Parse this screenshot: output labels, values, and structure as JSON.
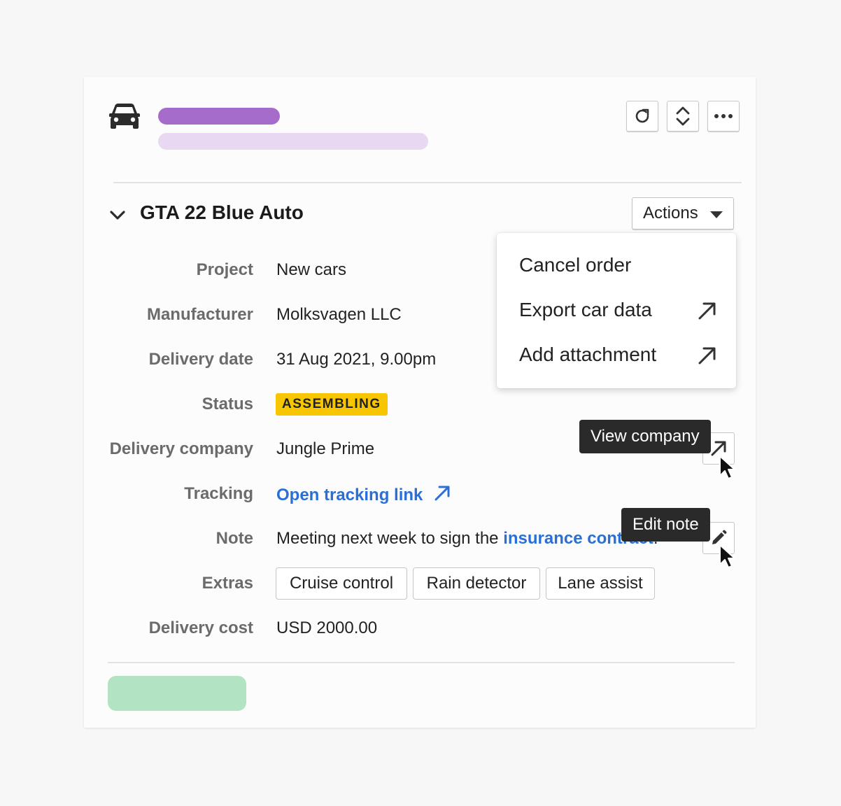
{
  "header": {
    "icon": "car-icon",
    "buttons": [
      {
        "name": "refresh-icon"
      },
      {
        "name": "expand-collapse-icon"
      },
      {
        "name": "more-icon"
      }
    ]
  },
  "section": {
    "title": "GTA 22 Blue Auto",
    "actions_label": "Actions"
  },
  "fields": {
    "project": {
      "label": "Project",
      "value": "New cars"
    },
    "manufacturer": {
      "label": "Manufacturer",
      "value": "Molksvagen LLC"
    },
    "delivery_date": {
      "label": "Delivery date",
      "value": "31 Aug 2021, 9.00pm"
    },
    "status": {
      "label": "Status",
      "value": "ASSEMBLING"
    },
    "delivery_company": {
      "label": "Delivery company",
      "value": "Jungle Prime"
    },
    "tracking": {
      "label": "Tracking",
      "value": "Open tracking link"
    },
    "note": {
      "label": "Note",
      "text_before": "Meeting next week to sign the ",
      "link": "insurance contract",
      "text_after": "."
    },
    "extras": {
      "label": "Extras",
      "tags": [
        "Cruise control",
        "Rain detector",
        "Lane assist"
      ]
    },
    "delivery_cost": {
      "label": "Delivery cost",
      "value": "USD 2000.00"
    }
  },
  "dropdown": {
    "items": [
      {
        "label": "Cancel order"
      },
      {
        "label": "Export car data",
        "icon": "external-link-icon"
      },
      {
        "label": "Add attachment",
        "icon": "external-link-icon"
      }
    ]
  },
  "tooltips": {
    "view_company": "View company",
    "edit_note": "Edit note"
  },
  "colors": {
    "title_placeholder": "#a66ccb",
    "subtitle_placeholder": "#e9d8f1",
    "status_badge": "#f7c600",
    "link": "#2a6fd6",
    "primary_placeholder": "#b2e3c2"
  }
}
